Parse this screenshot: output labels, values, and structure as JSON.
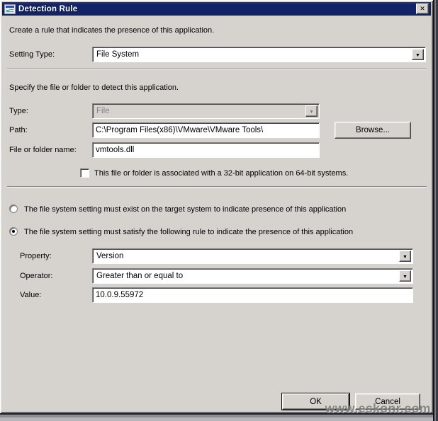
{
  "window": {
    "title": "Detection Rule"
  },
  "icons": {
    "close": "✕",
    "dropdown_arrow": "▼"
  },
  "intro": "Create a rule that indicates the presence of this application.",
  "setting_type": {
    "label": "Setting Type:",
    "value": "File System"
  },
  "file_section": {
    "heading": "Specify the file or folder to detect this application.",
    "type": {
      "label": "Type:",
      "value": "File"
    },
    "path": {
      "label": "Path:",
      "value": "C:\\Program Files(x86)\\VMware\\VMware Tools\\",
      "browse_label": "Browse..."
    },
    "file_name": {
      "label": "File or folder name:",
      "value": "vmtools.dll"
    },
    "checkbox_label": "This file or folder is associated with a 32-bit application on 64-bit systems.",
    "checkbox_checked": false
  },
  "rule_section": {
    "radio_exist_label": "The file system setting must exist on the target system to indicate presence of this application",
    "radio_satisfy_label": "The file system setting must satisfy the following rule to indicate the presence of this application",
    "selected_radio": "satisfy",
    "property": {
      "label": "Property:",
      "value": "Version"
    },
    "operator": {
      "label": "Operator:",
      "value": "Greater than or equal to"
    },
    "value": {
      "label": "Value:",
      "value": "10.0.9.55972"
    }
  },
  "buttons": {
    "ok": "OK",
    "cancel": "Cancel"
  },
  "watermark": "www.eskonr.com",
  "colors": {
    "titlebar": "#122368",
    "face": "#d6d3ce",
    "field_bg": "#ffffff",
    "disabled_text": "#848284",
    "title_text": "#ffffff"
  }
}
